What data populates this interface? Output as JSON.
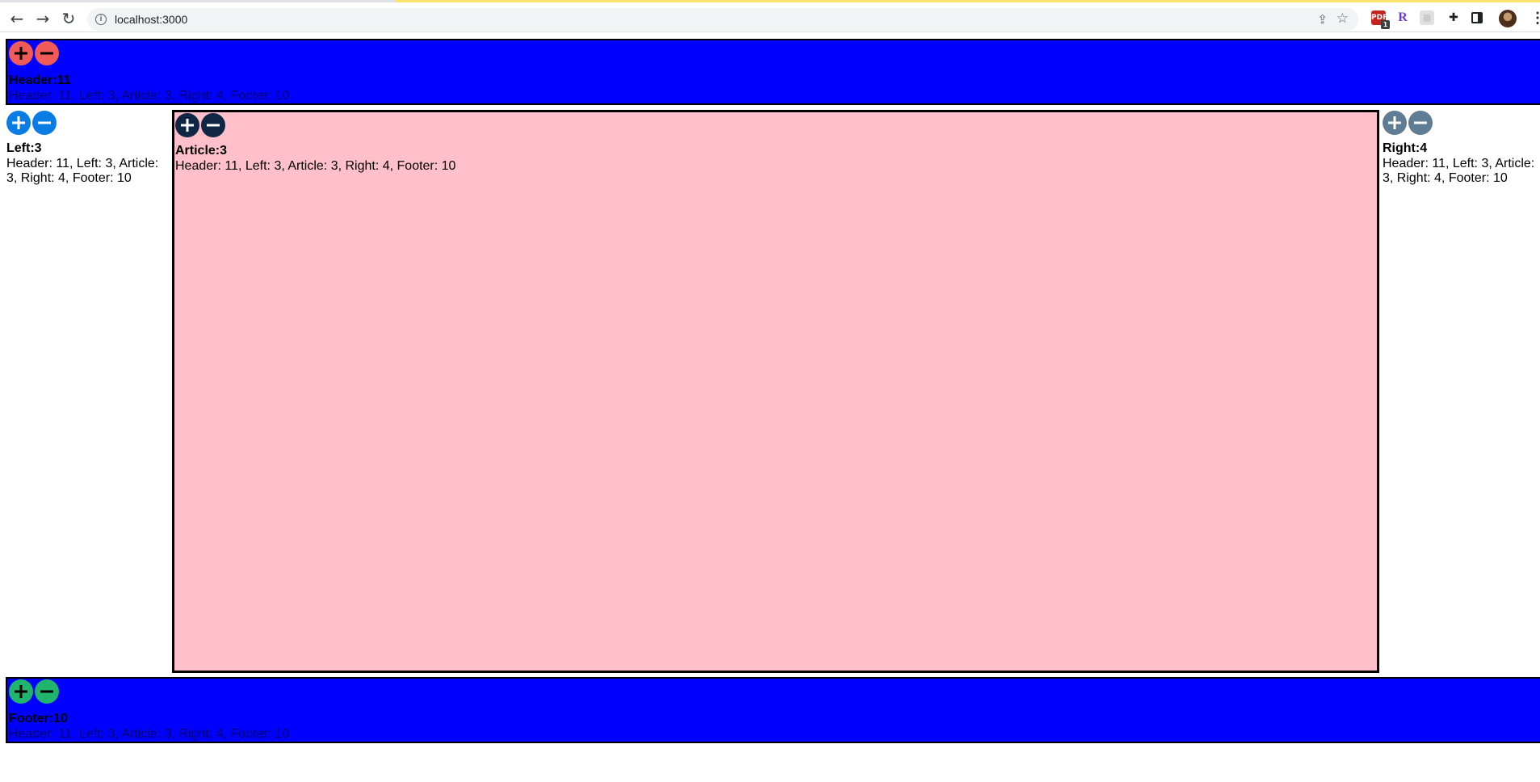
{
  "browser": {
    "url": "localhost:3000",
    "extensions": [
      "pdf-extension-icon",
      "r-extension-icon",
      "grey-extension-icon",
      "puzzle-icon",
      "side-panel-icon"
    ],
    "extension_badge": "1"
  },
  "sections": {
    "header": {
      "title": "Header:11",
      "info": "Header: 11, Left: 3, Article: 3, Right: 4, Footer: 10",
      "color": "#f05a57"
    },
    "left": {
      "title": "Left:3",
      "info": "Header: 11, Left: 3, Article: 3, Right: 4, Footer: 10",
      "color": "#0a7ce5"
    },
    "article": {
      "title": "Article:3",
      "info": "Header: 11, Left: 3, Article: 3, Right: 4, Footer: 10",
      "color": "#0f2745"
    },
    "right": {
      "title": "Right:4",
      "info": "Header: 11, Left: 3, Article: 3, Right: 4, Footer: 10",
      "color": "#5f7e95"
    },
    "footer": {
      "title": "Footer:10",
      "info": "Header: 11, Left: 3, Article: 3, Right: 4, Footer: 10",
      "color": "#20b46c"
    }
  },
  "colors": {
    "band": "#0000ff",
    "article_bg": "#ffc0cb"
  }
}
